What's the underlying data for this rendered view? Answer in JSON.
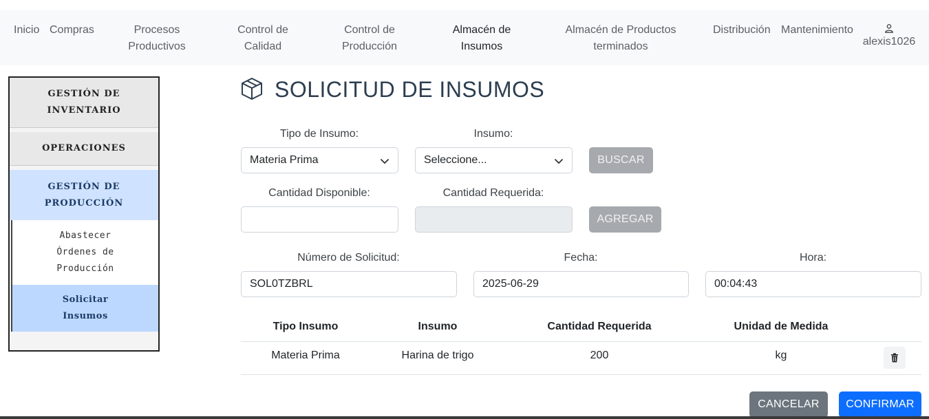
{
  "nav": {
    "items": [
      {
        "line1": "Inicio",
        "line2": ""
      },
      {
        "line1": "Compras",
        "line2": ""
      },
      {
        "line1": "Procesos",
        "line2": "Productivos"
      },
      {
        "line1": "Control de",
        "line2": "Calidad"
      },
      {
        "line1": "Control de",
        "line2": "Producción"
      },
      {
        "line1": "Almacén de",
        "line2": "Insumos"
      },
      {
        "line1": "Almacén de Productos",
        "line2": "terminados"
      },
      {
        "line1": "Distribución",
        "line2": ""
      },
      {
        "line1": "Mantenimiento",
        "line2": ""
      }
    ],
    "user": "alexis1026",
    "user_icon": "person-icon"
  },
  "sidebar": {
    "sections": [
      {
        "line1": "GESTIÓN DE",
        "line2": "INVENTARIO"
      },
      {
        "line1": "OPERACIONES",
        "line2": ""
      },
      {
        "line1": "GESTIÓN DE",
        "line2": "PRODUCCIÓN"
      }
    ],
    "subitems": [
      {
        "line1": "Abastecer",
        "line2": "Órdenes de",
        "line3": "Producción"
      },
      {
        "line1": "Solicitar",
        "line2": "Insumos",
        "line3": ""
      }
    ]
  },
  "page": {
    "title": "SOLICITUD DE INSUMOS",
    "title_icon": "box-icon"
  },
  "form": {
    "tipo_label": "Tipo de Insumo:",
    "tipo_value": "Materia Prima",
    "insumo_label": "Insumo:",
    "insumo_value": "Seleccione...",
    "buscar_label": "BUSCAR",
    "disponible_label": "Cantidad Disponible:",
    "disponible_value": "",
    "requerida_label": "Cantidad Requerida:",
    "requerida_value": "",
    "agregar_label": "AGREGAR",
    "numero_label": "Número de Solicitud:",
    "numero_value": "SOL0TZBRL",
    "fecha_label": "Fecha:",
    "fecha_value": "2025-06-29",
    "hora_label": "Hora:",
    "hora_value": "00:04:43"
  },
  "table": {
    "headers": [
      "Tipo Insumo",
      "Insumo",
      "Cantidad Requerida",
      "Unidad de Medida"
    ],
    "rows": [
      {
        "tipo": "Materia Prima",
        "insumo": "Harina de trigo",
        "cantidad": "200",
        "unidad": "kg"
      }
    ],
    "delete_icon": "trash-icon"
  },
  "actions": {
    "cancel_label": "CANCELAR",
    "confirm_label": "CONFIRMAR"
  },
  "colors": {
    "primary": "#0d6efd",
    "secondary": "#6c757d",
    "sidebar_active": "#cfe2ff"
  }
}
